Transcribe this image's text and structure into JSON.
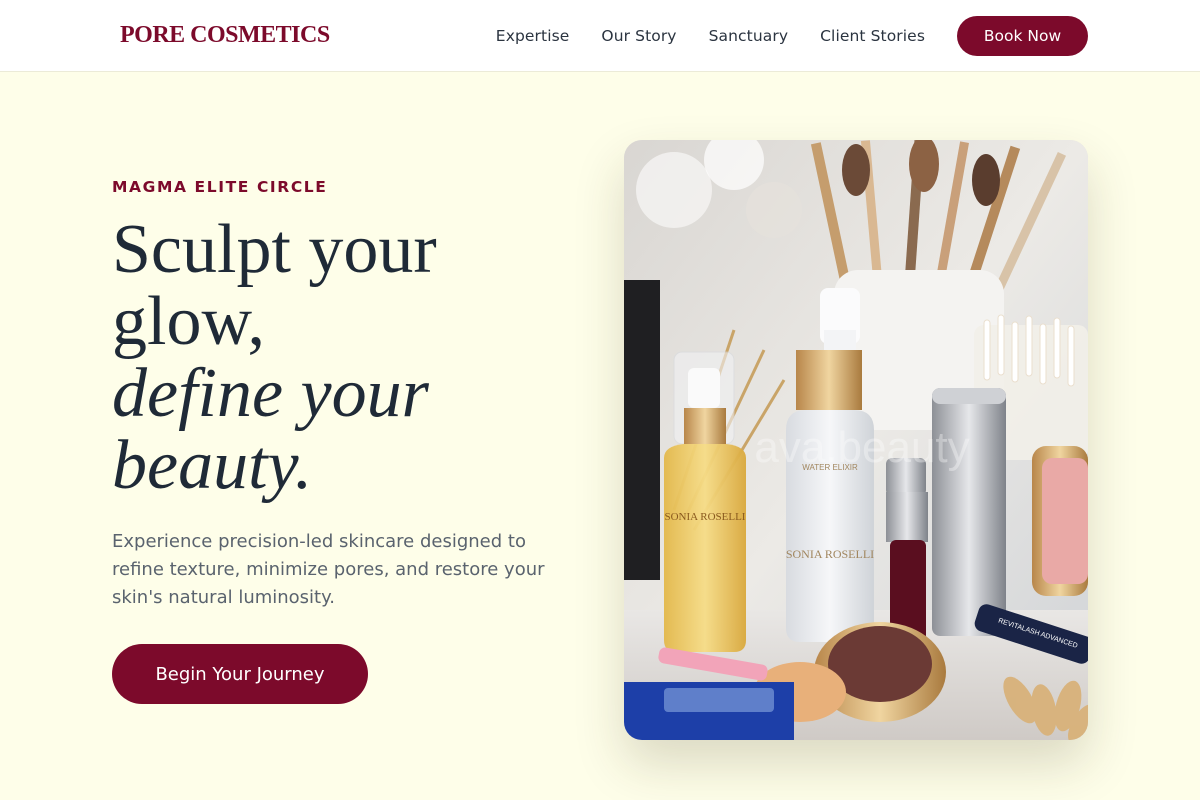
{
  "brand": {
    "name": "PORE COSMETICS",
    "color": "#7c0a2b"
  },
  "nav": {
    "links": [
      "Expertise",
      "Our Story",
      "Sanctuary",
      "Client Stories"
    ],
    "cta_label": "Book Now"
  },
  "hero": {
    "eyebrow": "MAGMA ELITE CIRCLE",
    "headline_line1": "Sculpt your",
    "headline_line2": "glow,",
    "headline_line3": "define your",
    "headline_line4": "beauty.",
    "subcopy": "Experience precision-led skincare designed to refine texture, minimize pores, and restore your skin's natural luminosity.",
    "cta_label": "Begin Your Journey",
    "image_watermark": "ava.beauty",
    "image_product_text": {
      "serum_brand": "SONIA ROSELLI",
      "serum_name": "WATER ELIXIR",
      "oil_brand": "SONIA ROSELLI",
      "tube_label": "REVITALASH ADVANCED"
    }
  },
  "colors": {
    "page_background": "#fefee9",
    "accent": "#7c0a2b",
    "heading": "#1f2a37",
    "body_text": "#5a636e"
  },
  "icons": [
    "makeup-brush-icon",
    "serum-bottle-icon",
    "oil-bottle-icon",
    "compact-icon"
  ]
}
